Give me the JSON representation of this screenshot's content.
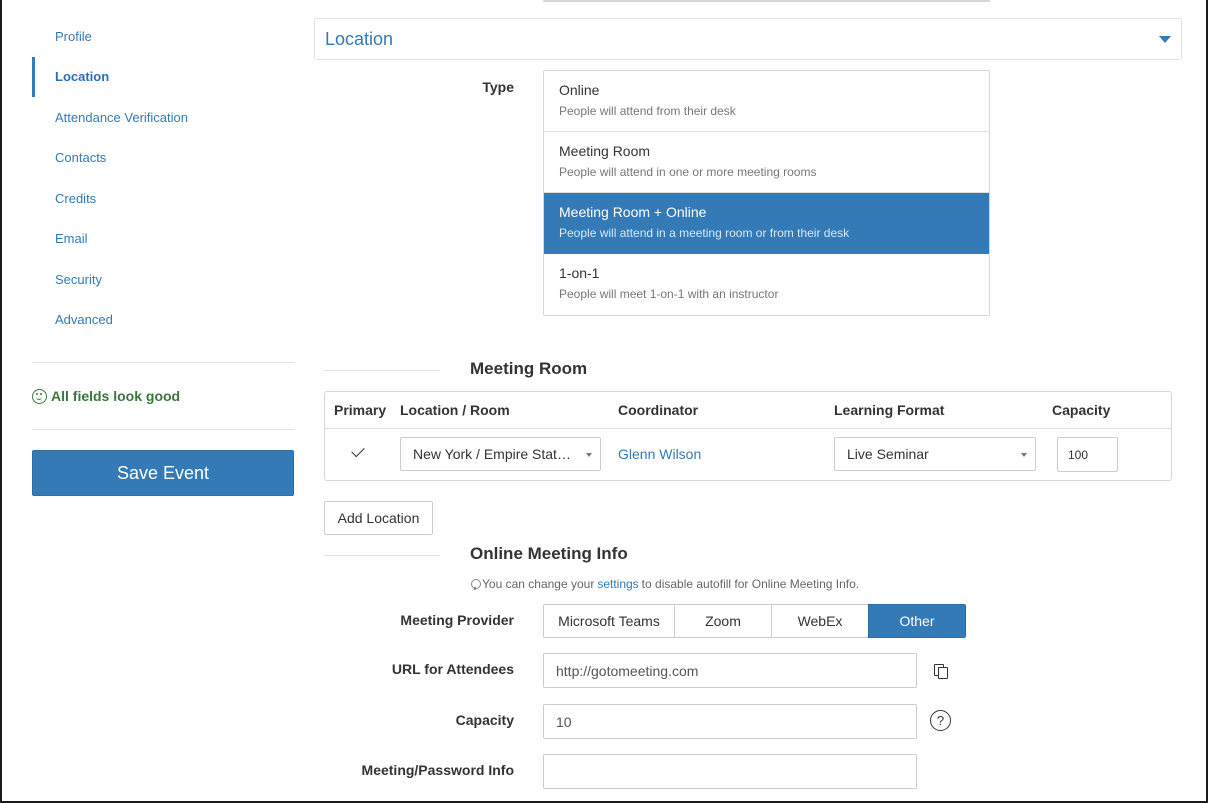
{
  "sidebar": {
    "items": [
      {
        "label": "Profile"
      },
      {
        "label": "Location"
      },
      {
        "label": "Attendance Verification"
      },
      {
        "label": "Contacts"
      },
      {
        "label": "Credits"
      },
      {
        "label": "Email"
      },
      {
        "label": "Security"
      },
      {
        "label": "Advanced"
      }
    ],
    "active_item": "Location",
    "status_text": "All fields look good",
    "status_icon": "smile-icon",
    "save_label": "Save Event"
  },
  "location": {
    "title": "Location",
    "type_label": "Type",
    "types": [
      {
        "name": "Online",
        "desc": "People will attend from their desk"
      },
      {
        "name": "Meeting Room",
        "desc": "People will attend in one or more meeting rooms"
      },
      {
        "name": "Meeting Room + Online",
        "desc": "People will attend in a meeting room or from their desk"
      },
      {
        "name": "1-on-1",
        "desc": "People will meet 1-on-1 with an instructor"
      }
    ],
    "selected_type": "Meeting Room + Online"
  },
  "meeting_room": {
    "heading": "Meeting Room",
    "columns": [
      "Primary",
      "Location / Room",
      "Coordinator",
      "Learning Format",
      "Capacity"
    ],
    "rows": [
      {
        "primary": true,
        "location_room": "New York / Empire State Building",
        "coordinator": "Glenn Wilson",
        "learning_format": "Live Seminar",
        "capacity": "100"
      }
    ],
    "add_location_label": "Add Location"
  },
  "online_meeting": {
    "heading": "Online Meeting Info",
    "hint_prefix": "You can change your",
    "hint_link": "settings",
    "hint_suffix": "to disable autofill for Online Meeting Info.",
    "provider_label": "Meeting Provider",
    "providers": [
      "Microsoft Teams",
      "Zoom",
      "WebEx",
      "Other"
    ],
    "selected_provider": "Other",
    "url_label": "URL for Attendees",
    "url_value": "http://gotomeeting.com",
    "capacity_label": "Capacity",
    "capacity_value": "10",
    "help_glyph": "?",
    "password_label": "Meeting/Password Info",
    "password_value": ""
  },
  "colors": {
    "accent": "#337ab7",
    "success": "#3c763d"
  }
}
